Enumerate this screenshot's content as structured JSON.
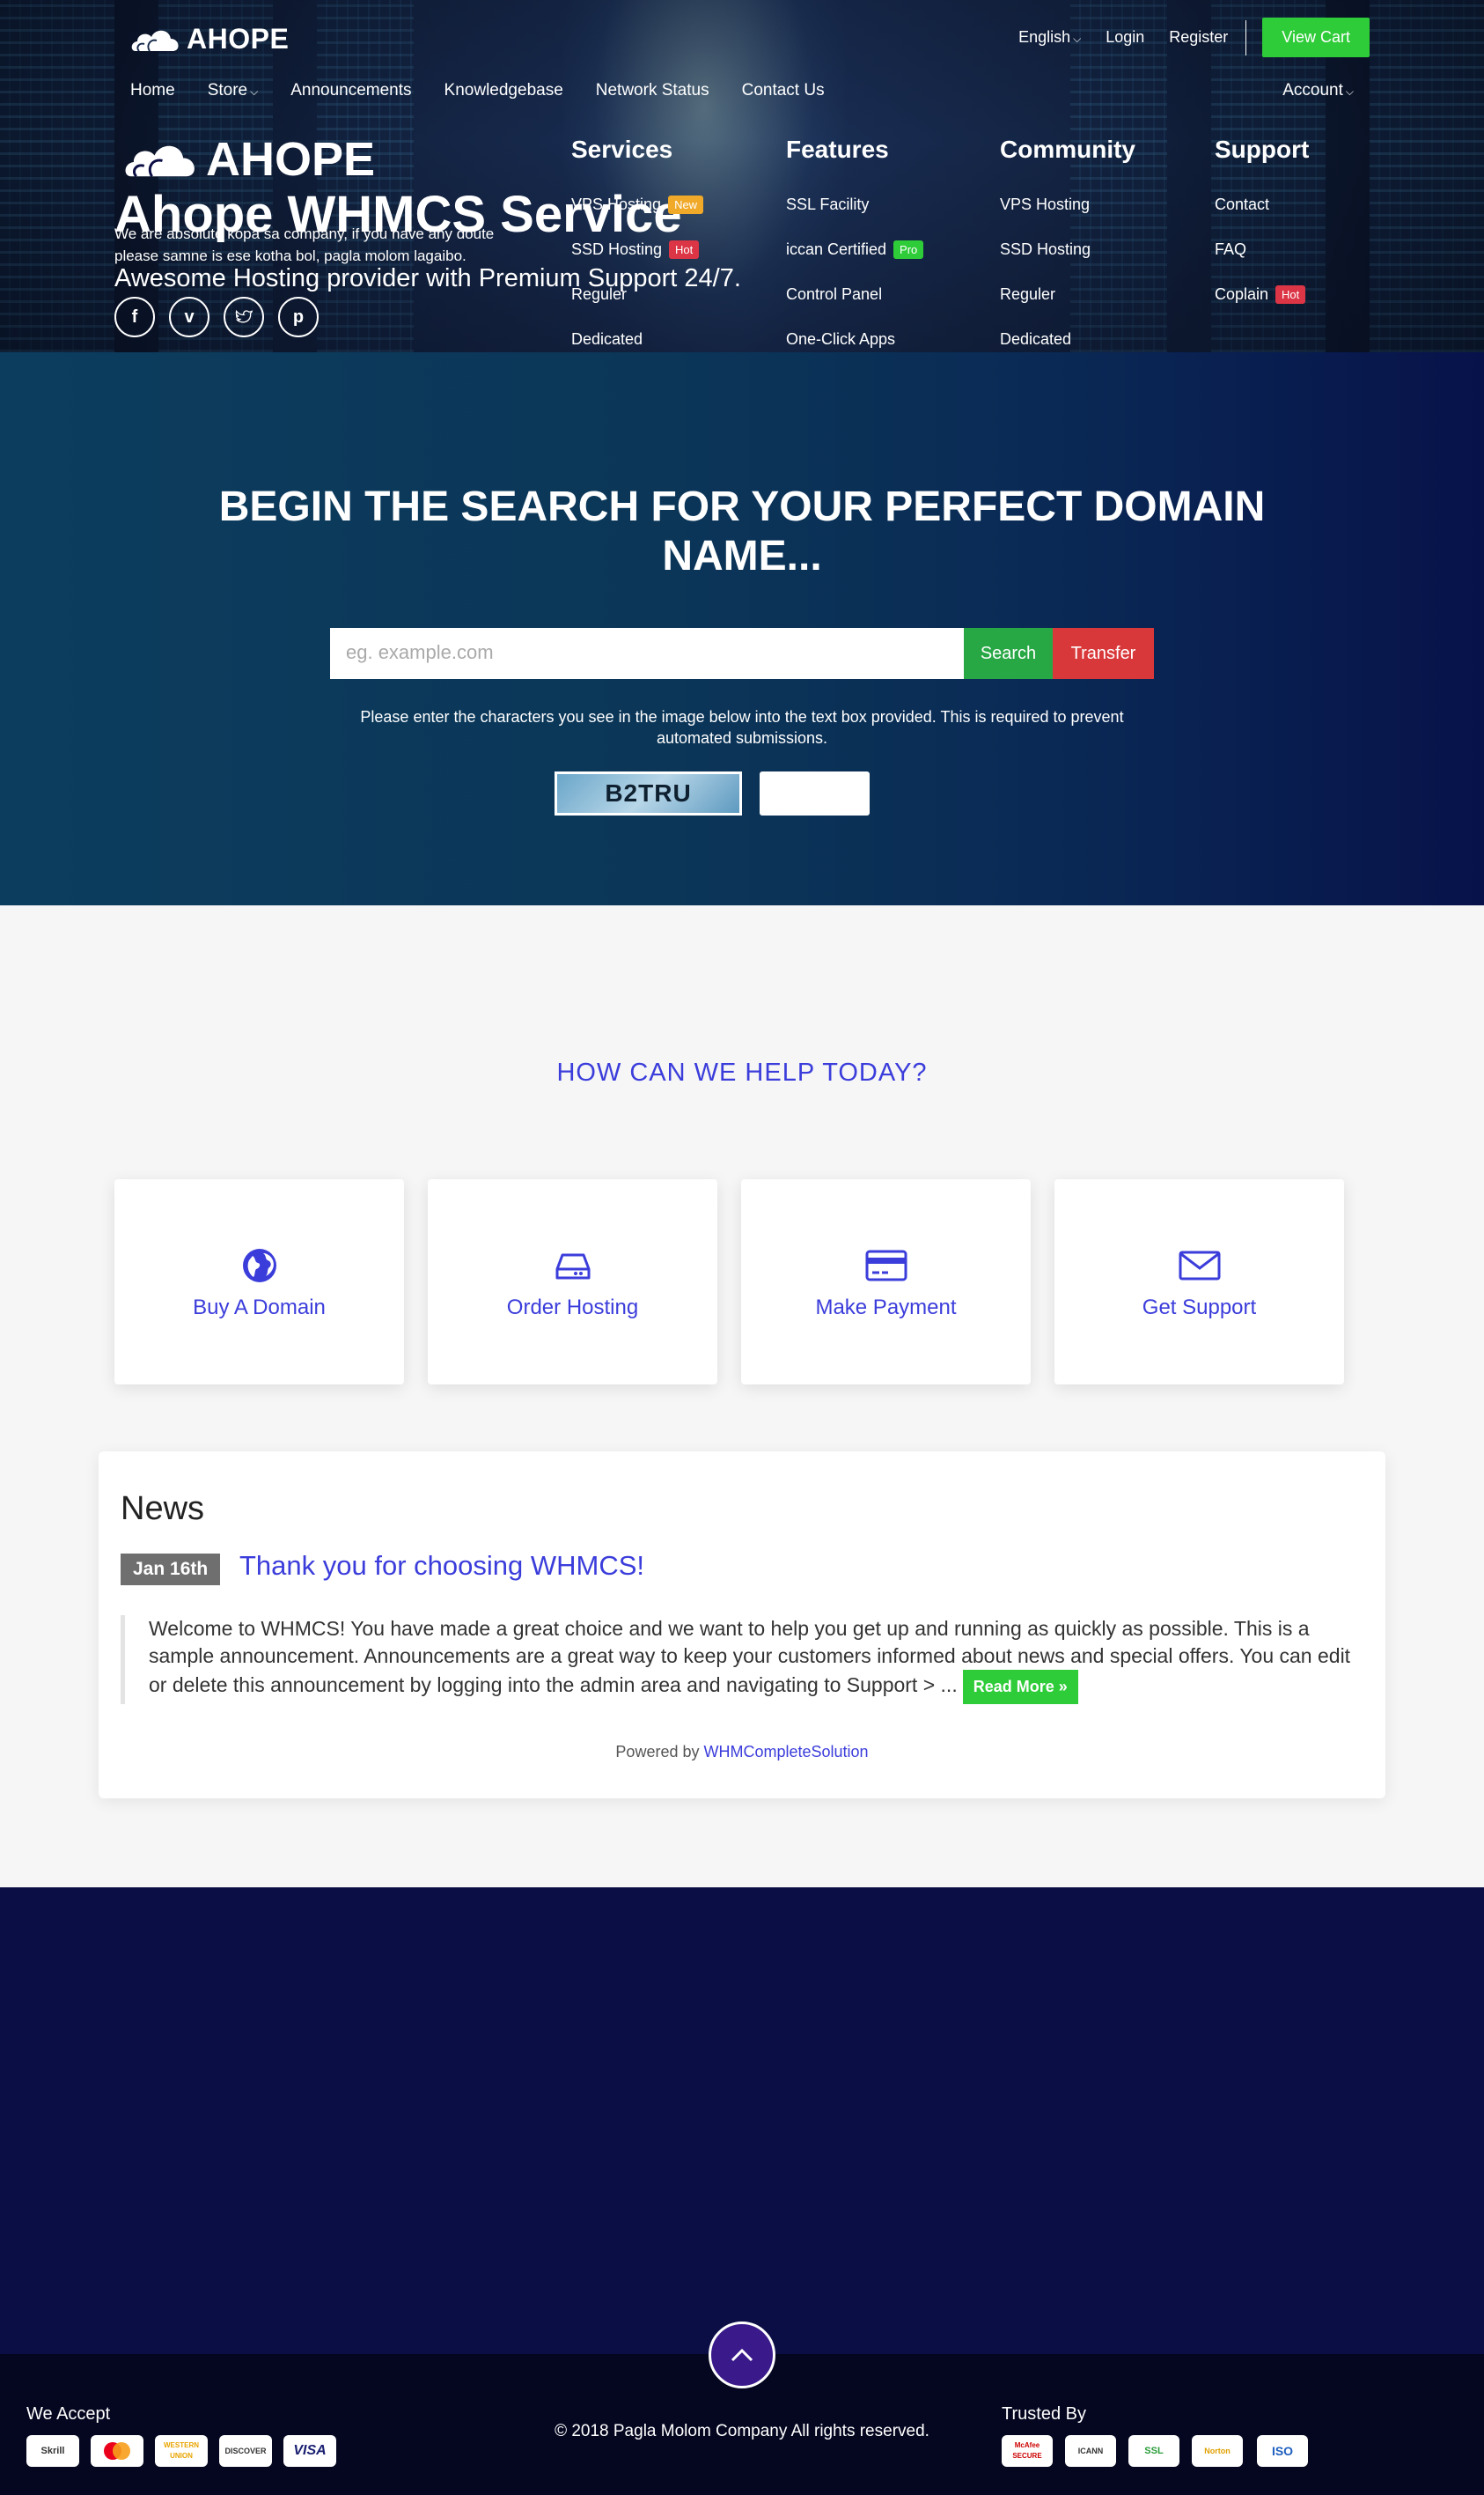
{
  "header": {
    "logo_text": "AHOPE",
    "top_links": {
      "language": "English",
      "login": "Login",
      "register": "Register",
      "cart": "View Cart"
    },
    "nav": [
      "Home",
      "Store",
      "Announcements",
      "Knowledgebase",
      "Network Status",
      "Contact Us"
    ],
    "account": "Account",
    "hero_title": "Ahope WHMCS Service",
    "hero_subtitle": "Awesome Hosting provider with Premium Support 24/7."
  },
  "domain_search": {
    "title": "BEGIN THE SEARCH FOR YOUR PERFECT DOMAIN NAME...",
    "placeholder": "eg. example.com",
    "search_button": "Search",
    "transfer_button": "Transfer",
    "captcha_note": "Please enter the characters you see in the image below into the text box provided. This is required to prevent automated submissions.",
    "captcha_text": "B2TRU"
  },
  "help": {
    "title": "HOW CAN WE HELP TODAY?",
    "cards": [
      {
        "label": "Buy A Domain",
        "icon": "globe-icon"
      },
      {
        "label": "Order Hosting",
        "icon": "hard-drive-icon"
      },
      {
        "label": "Make Payment",
        "icon": "credit-card-icon"
      },
      {
        "label": "Get Support",
        "icon": "envelope-icon"
      }
    ]
  },
  "news": {
    "heading": "News",
    "date": "Jan 16th",
    "title": "Thank you for choosing WHMCS!",
    "body": "Welcome to WHMCS! You have made a great choice and we want to help you get up and running as quickly as possible. This is a sample announcement. Announcements are a great way to keep your customers informed about news and special offers. You can edit or delete this announcement by logging into the admin area and navigating to Support > ...",
    "read_more": "Read More »",
    "powered_by": "Powered by",
    "powered_link": "WHMCompleteSolution"
  },
  "footer": {
    "logo_text": "AHOPE",
    "about": "We are absolute kopa sa company, if you have any doute please samne is ese kotha bol, pagla molom lagaibo.",
    "social": [
      "f",
      "v",
      "t",
      "p"
    ],
    "columns": [
      {
        "title": "Services",
        "items": [
          {
            "label": "VPS Hosting",
            "tag": "New",
            "tag_type": "new"
          },
          {
            "label": "SSD Hosting",
            "tag": "Hot",
            "tag_type": "hot"
          },
          {
            "label": "Reguler",
            "tag": ""
          },
          {
            "label": "Dedicated",
            "tag": ""
          }
        ]
      },
      {
        "title": "Features",
        "items": [
          {
            "label": "SSL Facility",
            "tag": ""
          },
          {
            "label": "iccan Certified",
            "tag": "Pro",
            "tag_type": "pro"
          },
          {
            "label": "Control Panel",
            "tag": ""
          },
          {
            "label": "One-Click Apps",
            "tag": ""
          }
        ]
      },
      {
        "title": "Community",
        "items": [
          {
            "label": "VPS Hosting",
            "tag": ""
          },
          {
            "label": "SSD Hosting",
            "tag": ""
          },
          {
            "label": "Reguler",
            "tag": ""
          },
          {
            "label": "Dedicated",
            "tag": ""
          }
        ]
      },
      {
        "title": "Support",
        "items": [
          {
            "label": "Contact",
            "tag": ""
          },
          {
            "label": "FAQ",
            "tag": ""
          },
          {
            "label": "Coplain",
            "tag": "Hot",
            "tag_type": "hot"
          }
        ]
      }
    ],
    "we_accept": "We Accept",
    "payments": [
      "Skrill",
      "MasterCard",
      "WESTERN UNION",
      "DISCOVER",
      "VISA"
    ],
    "copyright": "© 2018 Pagla Molom Company All rights reserved.",
    "trusted_by": "Trusted By",
    "trust_badges": [
      "McAfee SECURE",
      "ICANN",
      "SSL",
      "Norton",
      "ISO"
    ]
  },
  "colors": {
    "accent": "#3b3ddb",
    "green": "#2fcc39",
    "red": "#d9383a",
    "footer_bg": "#0b0d45"
  }
}
